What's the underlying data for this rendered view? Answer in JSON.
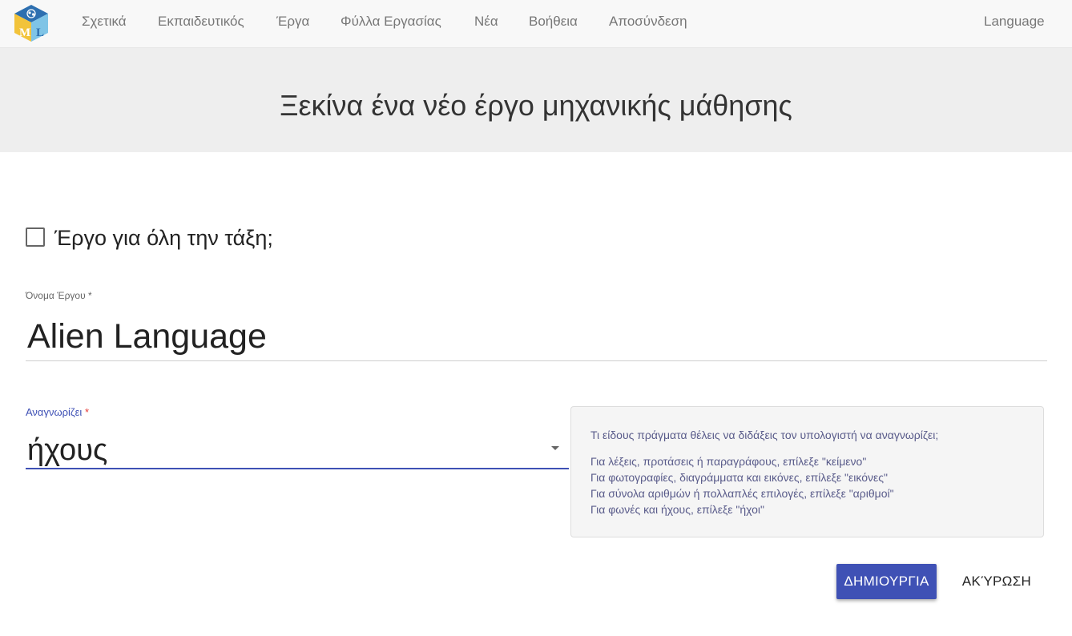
{
  "nav": {
    "logo_letters": [
      "M",
      "L"
    ],
    "links": [
      "Σχετικά",
      "Εκπαιδευτικός",
      "Έργα",
      "Φύλλα Εργασίας",
      "Νέα",
      "Βοήθεια",
      "Αποσύνδεση"
    ],
    "language": "Language"
  },
  "hero": {
    "title": "Ξεκίνα ένα νέο έργο μηχανικής μάθησης"
  },
  "form": {
    "class_project_label": "Έργο για όλη την τάξη;",
    "class_project_checked": false,
    "name_label": "Όνομα Έργου",
    "name_value": "Alien Language",
    "recognises_label": "Αναγνωρίζει",
    "recognises_value": "ήχους",
    "required_marker": "*"
  },
  "help": {
    "question": "Τι είδους πράγματα θέλεις να διδάξεις τον υπολογιστή να αναγνωρίζει;",
    "lines": [
      "Για λέξεις, προτάσεις ή παραγράφους, επίλεξε \"κείμενο\"",
      "Για φωτογραφίες, διαγράμματα και εικόνες, επίλεξε \"εικόνες\"",
      "Για σύνολα αριθμών ή πολλαπλές επιλογές, επίλεξε \"αριθμοί\"",
      "Για φωνές και ήχους, επίλεξε \"ήχοι\""
    ]
  },
  "buttons": {
    "create": "ΔΗΜΙΟΥΡΓΙΑ",
    "cancel": "ΑΚΎΡΩΣΗ"
  },
  "colors": {
    "accent": "#3f51b5",
    "navbar_bg": "#f8f8f8",
    "hero_bg": "#eeeeee",
    "required": "#e53935"
  }
}
